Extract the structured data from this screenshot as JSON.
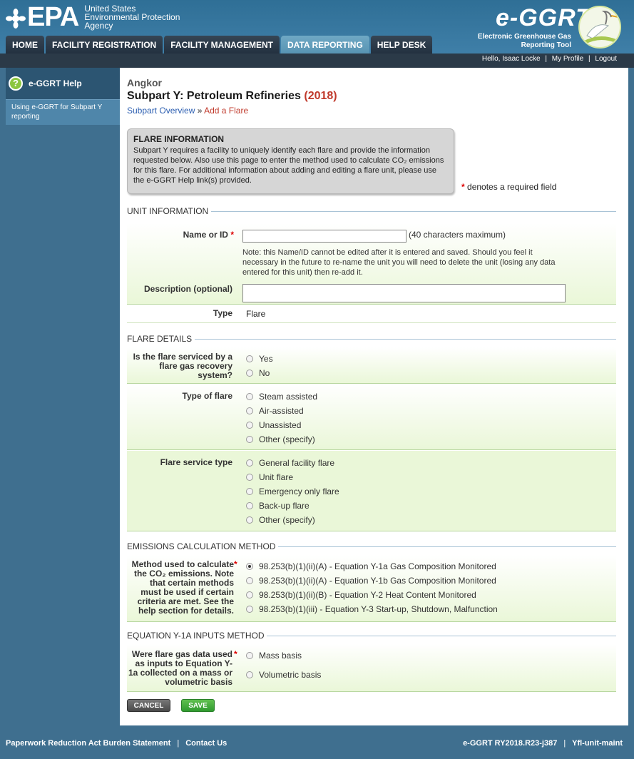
{
  "header": {
    "agency_line1": "United States",
    "agency_line2": "Environmental Protection",
    "agency_line3": "Agency",
    "epa_wordmark": "EPA",
    "eggrt_wordmark": "e-GGRT",
    "eggrt_sub1": "Electronic Greenhouse Gas",
    "eggrt_sub2": "Reporting Tool"
  },
  "nav": {
    "tabs": [
      "HOME",
      "FACILITY REGISTRATION",
      "FACILITY MANAGEMENT",
      "DATA REPORTING",
      "HELP DESK"
    ],
    "active_tab": "DATA REPORTING"
  },
  "userbar": {
    "greeting": "Hello, Isaac Locke",
    "my_profile": "My Profile",
    "logout": "Logout"
  },
  "sidebar": {
    "help_title": "e-GGRT Help",
    "help_link": "Using e-GGRT for Subpart Y reporting"
  },
  "page": {
    "facility": "Angkor",
    "title": "Subpart Y: Petroleum Refineries",
    "year": "(2018)",
    "breadcrumb_link": "Subpart Overview",
    "breadcrumb_sep": "»",
    "breadcrumb_current": "Add a Flare"
  },
  "info": {
    "title": "FLARE INFORMATION",
    "text": "Subpart Y requires a facility to uniquely identify each flare and provide the information requested below. Also use this page to enter the method used to calculate CO₂ emissions for this flare. For additional information about adding and editing a flare unit, please use the e-GGRT Help link(s) provided.",
    "required_note": "denotes a required field",
    "star": "*"
  },
  "unit_info": {
    "section": "UNIT INFORMATION",
    "name_label": "Name or ID",
    "name_value": "",
    "name_hint": "(40 characters maximum)",
    "name_note": "Note: this Name/ID cannot be edited after it is entered and saved. Should you feel it necessary in the future to re-name the unit you will need to delete the unit (losing any data entered for this unit) then re-add it.",
    "desc_label": "Description (optional)",
    "desc_value": "",
    "type_label": "Type",
    "type_value": "Flare"
  },
  "flare_details": {
    "section": "FLARE DETAILS",
    "recovery_label": "Is the flare serviced by a flare gas recovery system?",
    "recovery_options": [
      "Yes",
      "No"
    ],
    "type_label": "Type of flare",
    "type_options": [
      "Steam assisted",
      "Air-assisted",
      "Unassisted",
      "Other (specify)"
    ],
    "service_label": "Flare service type",
    "service_options": [
      "General facility flare",
      "Unit flare",
      "Emergency only flare",
      "Back-up flare",
      "Other (specify)"
    ]
  },
  "emissions": {
    "section": "EMISSIONS CALCULATION METHOD",
    "method_label": "Method used to calculate the CO₂ emissions. Note that certain methods must be used if certain criteria are met. See the help section for details.",
    "method_options": [
      "98.253(b)(1)(ii)(A) - Equation Y-1a Gas Composition Monitored",
      "98.253(b)(1)(ii)(A) - Equation Y-1b Gas Composition Monitored",
      "98.253(b)(1)(ii)(B) - Equation Y-2 Heat Content Monitored",
      "98.253(b)(1)(iii) - Equation Y-3 Start-up, Shutdown, Malfunction"
    ],
    "selected_index": 0
  },
  "equation": {
    "section": "EQUATION Y-1A INPUTS METHOD",
    "basis_label": "Were flare gas data used as inputs to Equation Y-1a collected on a mass or volumetric basis",
    "basis_options": [
      "Mass basis",
      "Volumetric basis"
    ]
  },
  "buttons": {
    "cancel": "CANCEL",
    "save": "SAVE"
  },
  "footer": {
    "burden": "Paperwork Reduction Act Burden Statement",
    "contact": "Contact Us",
    "version": "e-GGRT RY2018.R23-j387",
    "page_id": "Yfl-unit-maint"
  }
}
